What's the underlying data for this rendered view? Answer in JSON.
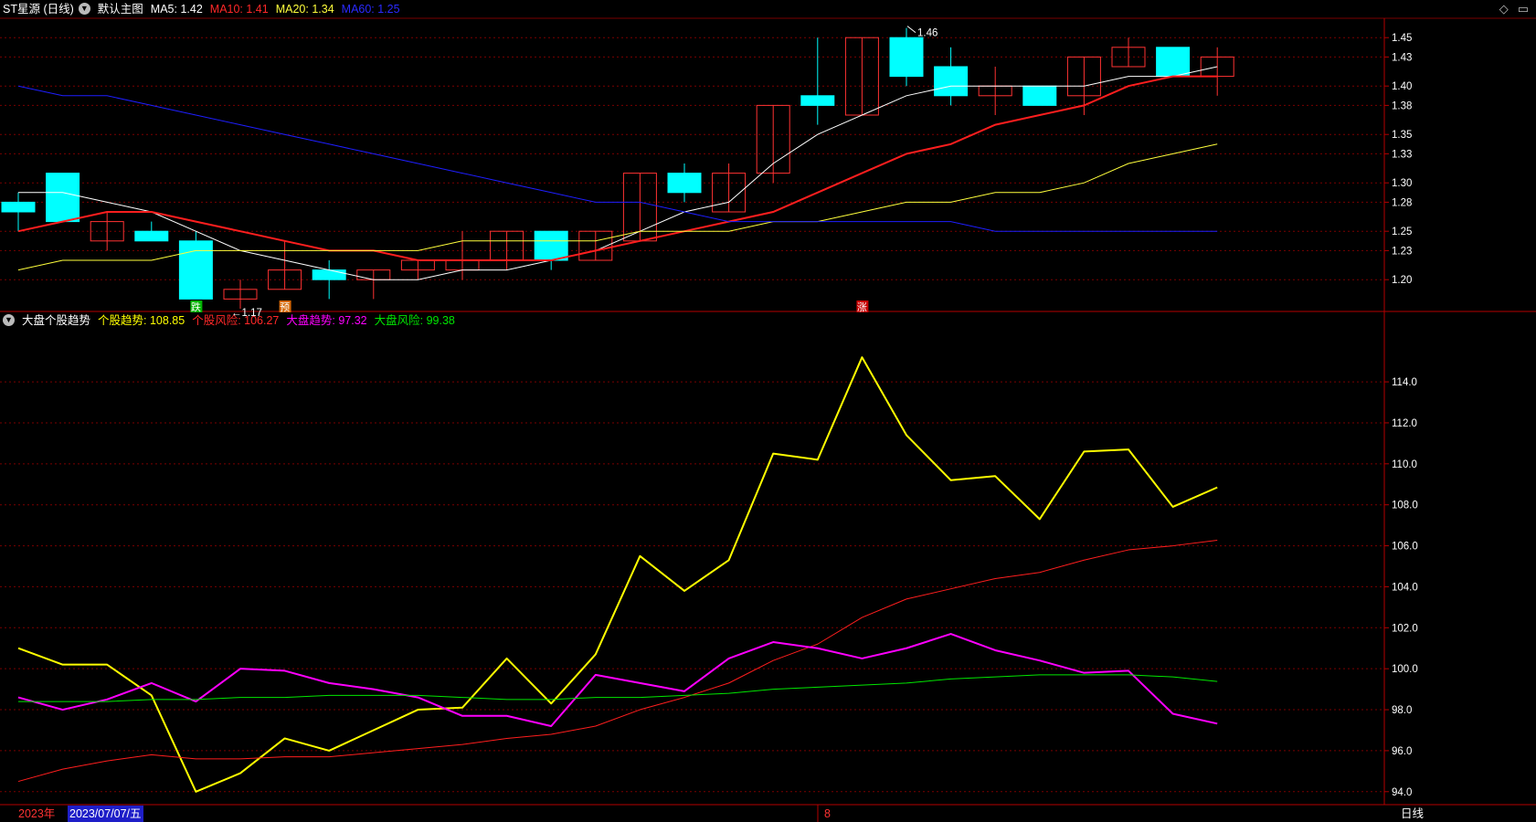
{
  "header": {
    "stock_name": "ST星源 (日线)",
    "template_label": "默认主图",
    "ma5": "MA5: 1.42",
    "ma10": "MA10: 1.41",
    "ma20": "MA20: 1.34",
    "ma60": "MA60: 1.25"
  },
  "indicator_header": {
    "name": "大盘个股趋势",
    "stock_trend": "个股趋势: 108.85",
    "stock_risk": "个股风险: 106.27",
    "market_trend": "大盘趋势: 97.32",
    "market_risk": "大盘风险: 99.38"
  },
  "footer": {
    "year": "2023年",
    "cursor_date": "2023/07/07/五",
    "month_tick": "8",
    "period": "日线"
  },
  "colors": {
    "up": "#ff3232",
    "down": "#00ffff",
    "ma5": "#ffffff",
    "ma10": "#ff1e1e",
    "ma20": "#ffff3c",
    "ma60": "#1e1eff",
    "stock_trend": "#ffff00",
    "stock_risk": "#ff1e1e",
    "market_trend": "#ff00ff",
    "market_risk": "#00e600",
    "grid": "#7a0000"
  },
  "chart_data": [
    {
      "type": "candlestick",
      "ylim": [
        1.17,
        1.47
      ],
      "y_ticks": [
        "1.45",
        "1.43",
        "1.40",
        "1.38",
        "1.35",
        "1.33",
        "1.30",
        "1.28",
        "1.25",
        "1.23",
        "1.20"
      ],
      "annotations": [
        {
          "text": "←1.17",
          "candle": 5,
          "value": 1.17
        },
        {
          "text": "1.46",
          "candle": 20,
          "value": 1.46
        }
      ],
      "signals": [
        {
          "text": "跌",
          "candle": 4,
          "color": "#00b400"
        },
        {
          "text": "预",
          "candle": 6,
          "color": "#d26400"
        },
        {
          "text": "涨",
          "candle": 19,
          "color": "#c80000"
        }
      ],
      "candles": [
        {
          "o": 1.28,
          "h": 1.29,
          "l": 1.25,
          "c": 1.27
        },
        {
          "o": 1.31,
          "h": 1.31,
          "l": 1.26,
          "c": 1.26
        },
        {
          "o": 1.24,
          "h": 1.27,
          "l": 1.23,
          "c": 1.26
        },
        {
          "o": 1.25,
          "h": 1.26,
          "l": 1.24,
          "c": 1.24
        },
        {
          "o": 1.24,
          "h": 1.25,
          "l": 1.18,
          "c": 1.18
        },
        {
          "o": 1.18,
          "h": 1.2,
          "l": 1.17,
          "c": 1.19
        },
        {
          "o": 1.19,
          "h": 1.24,
          "l": 1.19,
          "c": 1.21
        },
        {
          "o": 1.21,
          "h": 1.22,
          "l": 1.18,
          "c": 1.2
        },
        {
          "o": 1.2,
          "h": 1.21,
          "l": 1.18,
          "c": 1.21
        },
        {
          "o": 1.21,
          "h": 1.22,
          "l": 1.2,
          "c": 1.22
        },
        {
          "o": 1.21,
          "h": 1.25,
          "l": 1.2,
          "c": 1.22
        },
        {
          "o": 1.22,
          "h": 1.25,
          "l": 1.21,
          "c": 1.25
        },
        {
          "o": 1.25,
          "h": 1.25,
          "l": 1.21,
          "c": 1.22
        },
        {
          "o": 1.22,
          "h": 1.25,
          "l": 1.22,
          "c": 1.25
        },
        {
          "o": 1.24,
          "h": 1.31,
          "l": 1.24,
          "c": 1.31
        },
        {
          "o": 1.31,
          "h": 1.32,
          "l": 1.28,
          "c": 1.29
        },
        {
          "o": 1.27,
          "h": 1.32,
          "l": 1.27,
          "c": 1.31
        },
        {
          "o": 1.31,
          "h": 1.38,
          "l": 1.3,
          "c": 1.38
        },
        {
          "o": 1.39,
          "h": 1.45,
          "l": 1.36,
          "c": 1.38
        },
        {
          "o": 1.37,
          "h": 1.45,
          "l": 1.37,
          "c": 1.45
        },
        {
          "o": 1.45,
          "h": 1.46,
          "l": 1.4,
          "c": 1.41
        },
        {
          "o": 1.42,
          "h": 1.44,
          "l": 1.38,
          "c": 1.39
        },
        {
          "o": 1.39,
          "h": 1.42,
          "l": 1.37,
          "c": 1.4
        },
        {
          "o": 1.4,
          "h": 1.4,
          "l": 1.38,
          "c": 1.38
        },
        {
          "o": 1.39,
          "h": 1.43,
          "l": 1.37,
          "c": 1.43
        },
        {
          "o": 1.42,
          "h": 1.45,
          "l": 1.42,
          "c": 1.44
        },
        {
          "o": 1.44,
          "h": 1.44,
          "l": 1.41,
          "c": 1.41
        },
        {
          "o": 1.41,
          "h": 1.44,
          "l": 1.39,
          "c": 1.43
        }
      ],
      "series": [
        {
          "name": "MA5",
          "values": [
            1.29,
            1.29,
            1.28,
            1.27,
            1.25,
            1.23,
            1.22,
            1.21,
            1.2,
            1.2,
            1.21,
            1.21,
            1.22,
            1.23,
            1.25,
            1.27,
            1.28,
            1.32,
            1.35,
            1.37,
            1.39,
            1.4,
            1.4,
            1.4,
            1.4,
            1.41,
            1.41,
            1.42
          ]
        },
        {
          "name": "MA10",
          "values": [
            1.25,
            1.26,
            1.27,
            1.27,
            1.26,
            1.25,
            1.24,
            1.23,
            1.23,
            1.22,
            1.22,
            1.22,
            1.22,
            1.23,
            1.24,
            1.25,
            1.26,
            1.27,
            1.29,
            1.31,
            1.33,
            1.34,
            1.36,
            1.37,
            1.38,
            1.4,
            1.41,
            1.41
          ]
        },
        {
          "name": "MA20",
          "values": [
            1.21,
            1.22,
            1.22,
            1.22,
            1.23,
            1.23,
            1.23,
            1.23,
            1.23,
            1.23,
            1.24,
            1.24,
            1.24,
            1.24,
            1.25,
            1.25,
            1.25,
            1.26,
            1.26,
            1.27,
            1.28,
            1.28,
            1.29,
            1.29,
            1.3,
            1.32,
            1.33,
            1.34
          ]
        },
        {
          "name": "MA60",
          "values": [
            1.4,
            1.39,
            1.39,
            1.38,
            1.37,
            1.36,
            1.35,
            1.34,
            1.33,
            1.32,
            1.31,
            1.3,
            1.29,
            1.28,
            1.28,
            1.27,
            1.26,
            1.26,
            1.26,
            1.26,
            1.26,
            1.26,
            1.25,
            1.25,
            1.25,
            1.25,
            1.25,
            1.25
          ]
        }
      ]
    },
    {
      "type": "line",
      "ylim": [
        93.5,
        116.5
      ],
      "y_ticks": [
        "114.0",
        "112.0",
        "110.0",
        "108.0",
        "106.0",
        "104.0",
        "102.0",
        "100.0",
        "98.0",
        "96.0",
        "94.0"
      ],
      "series": [
        {
          "name": "个股趋势",
          "values": [
            101.0,
            100.2,
            100.2,
            98.7,
            94.0,
            94.9,
            96.6,
            96.0,
            97.0,
            98.0,
            98.1,
            100.5,
            98.3,
            100.7,
            105.5,
            103.8,
            105.3,
            110.5,
            110.2,
            115.2,
            111.4,
            109.2,
            109.4,
            107.3,
            110.6,
            110.7,
            107.9,
            108.85
          ]
        },
        {
          "name": "个股风险",
          "values": [
            94.5,
            95.1,
            95.5,
            95.8,
            95.6,
            95.6,
            95.7,
            95.7,
            95.9,
            96.1,
            96.3,
            96.6,
            96.8,
            97.2,
            98.0,
            98.6,
            99.3,
            100.4,
            101.2,
            102.5,
            103.4,
            103.9,
            104.4,
            104.7,
            105.3,
            105.8,
            106.0,
            106.27
          ]
        },
        {
          "name": "大盘趋势",
          "values": [
            98.6,
            98.0,
            98.5,
            99.3,
            98.4,
            100.0,
            99.9,
            99.3,
            99.0,
            98.6,
            97.7,
            97.7,
            97.2,
            99.7,
            99.3,
            98.9,
            100.5,
            101.3,
            101.0,
            100.5,
            101.0,
            101.7,
            100.9,
            100.4,
            99.8,
            99.9,
            97.8,
            97.32
          ]
        },
        {
          "name": "大盘风险",
          "values": [
            98.4,
            98.4,
            98.4,
            98.5,
            98.5,
            98.6,
            98.6,
            98.7,
            98.7,
            98.7,
            98.6,
            98.5,
            98.5,
            98.6,
            98.6,
            98.7,
            98.8,
            99.0,
            99.1,
            99.2,
            99.3,
            99.5,
            99.6,
            99.7,
            99.7,
            99.7,
            99.6,
            99.38
          ]
        }
      ]
    }
  ]
}
